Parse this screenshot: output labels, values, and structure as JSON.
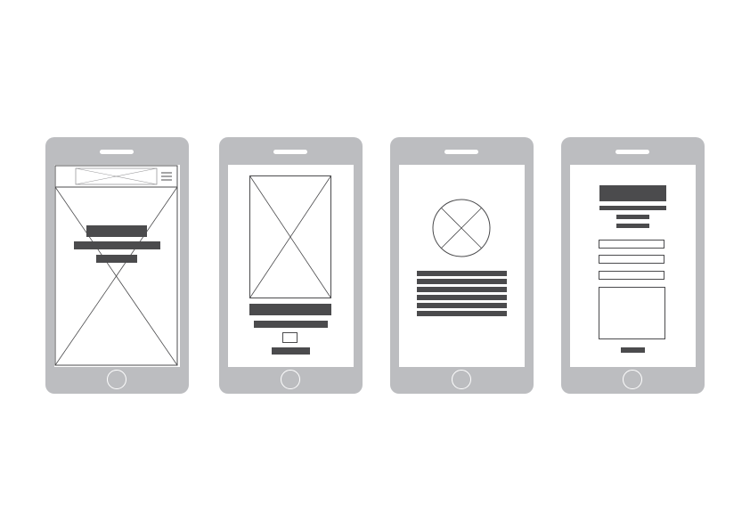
{
  "title": "",
  "colors": {
    "phone_body": "#bcbdc0",
    "screen": "#ffffff",
    "placeholder_stroke": "#4b4b4d",
    "text_bar": "#4b4b4d"
  },
  "icons": {
    "menu": "hamburger-menu-icon",
    "image": "image-placeholder-cross-icon",
    "avatar": "circle-placeholder-cross-icon"
  },
  "screens": [
    {
      "name": "landing-page",
      "elements": [
        "header-logo-placeholder",
        "menu-icon",
        "hero-image-placeholder",
        "headline",
        "subheadline",
        "cta-button"
      ]
    },
    {
      "name": "product-page",
      "elements": [
        "image-placeholder",
        "title",
        "subtitle",
        "checkbox",
        "button"
      ]
    },
    {
      "name": "profile-page",
      "elements": [
        "avatar-placeholder",
        "text-lines"
      ]
    },
    {
      "name": "form-page",
      "elements": [
        "header",
        "subtitle",
        "input-fields",
        "textarea",
        "submit-button"
      ]
    }
  ]
}
